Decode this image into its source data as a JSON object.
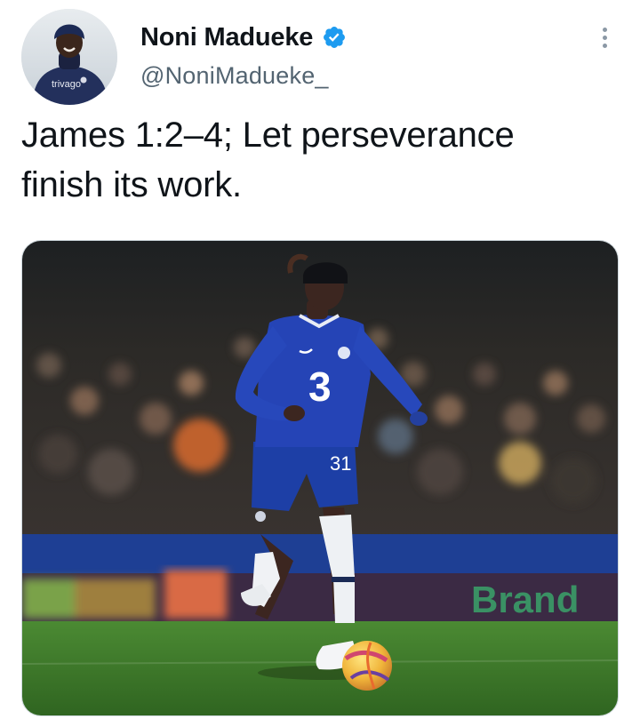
{
  "tweet": {
    "author": {
      "display_name": "Noni Madueke",
      "handle": "@NoniMadueke_",
      "verified": true,
      "avatar_shirt_text": "trivago"
    },
    "text_line1": "James 1:2–4; Let perseverance",
    "text_line2": "finish its work.",
    "media": {
      "shirt_number": "31",
      "sponsor_mark": "3",
      "board_text": "Brand"
    }
  },
  "colors": {
    "verified_blue": "#1d9bf0",
    "chelsea_blue": "#1f3fa8",
    "pitch_green": "#3f7a2c"
  }
}
